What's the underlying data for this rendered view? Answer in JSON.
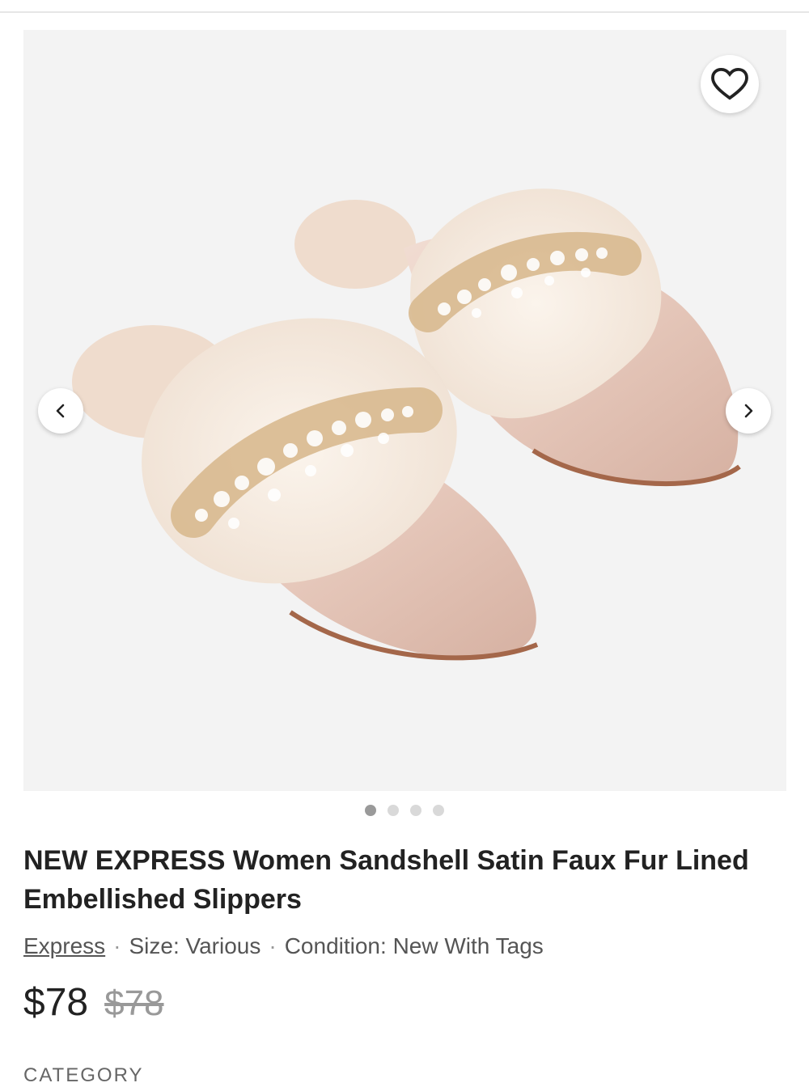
{
  "listing": {
    "title": "NEW EXPRESS Women Sandshell Satin Faux Fur Lined Embellished Slippers",
    "brand": "Express",
    "size": "Size: Various",
    "condition": "Condition: New With Tags",
    "separator": "·",
    "price": "$78",
    "original_price": "$78",
    "category_label": "CATEGORY"
  },
  "gallery": {
    "image_count": 4,
    "active_index": 0,
    "image_subject": "pink satin slippers with faux fur and crystal embellishment"
  },
  "icons": {
    "like": "heart-icon",
    "prev": "chevron-left-icon",
    "next": "chevron-right-icon"
  },
  "colors": {
    "background": "#ffffff",
    "image_bg": "#f3f3f3",
    "text_primary": "#222222",
    "text_secondary": "#555555",
    "strike_price": "#999999"
  }
}
